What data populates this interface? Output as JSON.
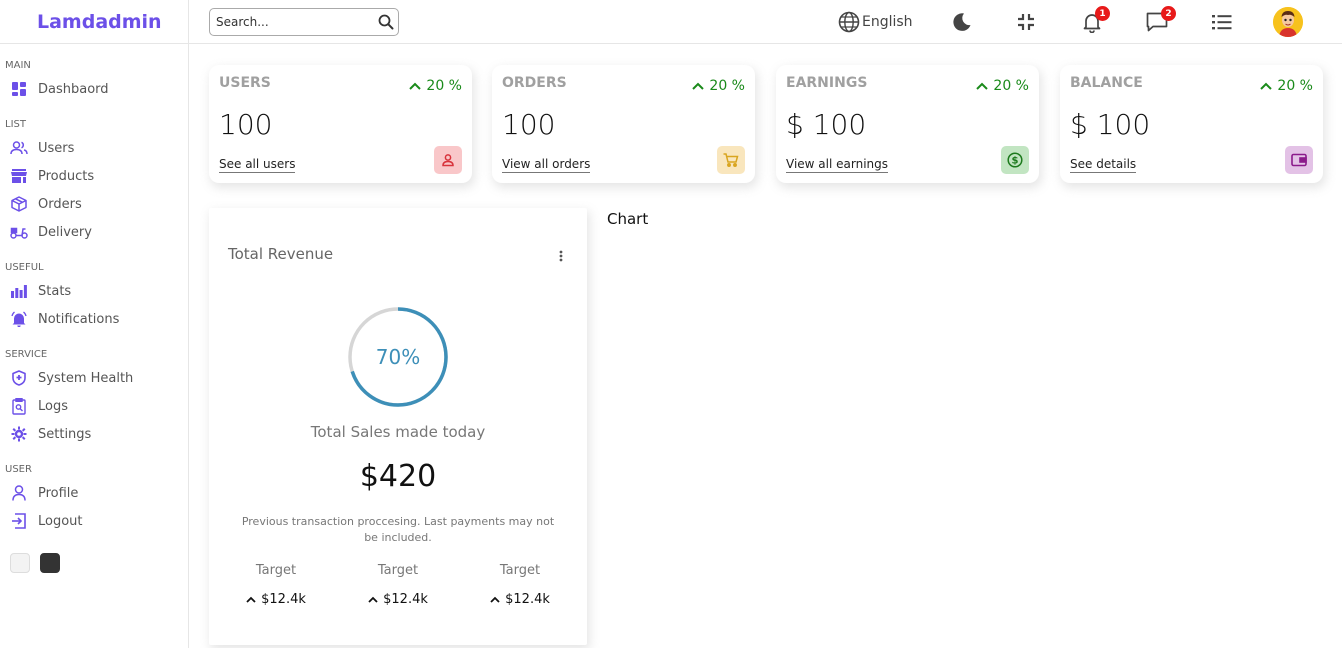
{
  "app": {
    "logo": "Lamdadmin"
  },
  "sidebar": {
    "sections": [
      {
        "title": "MAIN",
        "items": [
          {
            "label": "Dashbaord",
            "icon": "dashboard-icon"
          }
        ]
      },
      {
        "title": "LIST",
        "items": [
          {
            "label": "Users",
            "icon": "users-icon"
          },
          {
            "label": "Products",
            "icon": "store-icon"
          },
          {
            "label": "Orders",
            "icon": "box-icon"
          },
          {
            "label": "Delivery",
            "icon": "scooter-icon"
          }
        ]
      },
      {
        "title": "USEFUL",
        "items": [
          {
            "label": "Stats",
            "icon": "bar-chart-icon"
          },
          {
            "label": "Notifications",
            "icon": "bell-icon"
          }
        ]
      },
      {
        "title": "SERVICE",
        "items": [
          {
            "label": "System Health",
            "icon": "shield-icon"
          },
          {
            "label": "Logs",
            "icon": "clipboard-icon"
          },
          {
            "label": "Settings",
            "icon": "gear-icon"
          }
        ]
      },
      {
        "title": "USER",
        "items": [
          {
            "label": "Profile",
            "icon": "person-icon"
          },
          {
            "label": "Logout",
            "icon": "logout-icon"
          }
        ]
      }
    ],
    "themes": [
      "light",
      "dark"
    ]
  },
  "navbar": {
    "search_placeholder": "Search...",
    "language": "English",
    "notifications_count": "1",
    "messages_count": "2"
  },
  "widgets": [
    {
      "title": "USERS",
      "percent": "20 %",
      "value": "100",
      "link": "See all users",
      "icon": "person-outline-icon",
      "icon_color": "#d8333c",
      "icon_bg": "#f9c7c9"
    },
    {
      "title": "ORDERS",
      "percent": "20 %",
      "value": "100",
      "link": "View all orders",
      "icon": "cart-icon",
      "icon_color": "#d9a520",
      "icon_bg": "#f9e6bd"
    },
    {
      "title": "EARNINGS",
      "percent": "20 %",
      "value": "$ 100",
      "link": "View all earnings",
      "icon": "dollar-icon",
      "icon_color": "#1d7a1d",
      "icon_bg": "#c2e5c2"
    },
    {
      "title": "BALANCE",
      "percent": "20 %",
      "value": "$ 100",
      "link": "See details",
      "icon": "wallet-icon",
      "icon_color": "#8b1a8b",
      "icon_bg": "#e3c2e6"
    }
  ],
  "featured": {
    "title": "Total Revenue",
    "progress_percent": 70,
    "progress_label": "70%",
    "subtitle": "Total Sales made today",
    "amount": "$420",
    "description": "Previous transaction proccesing. Last payments may not be included.",
    "targets": [
      {
        "label": "Target",
        "value": "$12.4k"
      },
      {
        "label": "Target",
        "value": "$12.4k"
      },
      {
        "label": "Target",
        "value": "$12.4k"
      }
    ],
    "ring_color": "#3d8fb8"
  },
  "chart": {
    "title": "Chart"
  }
}
